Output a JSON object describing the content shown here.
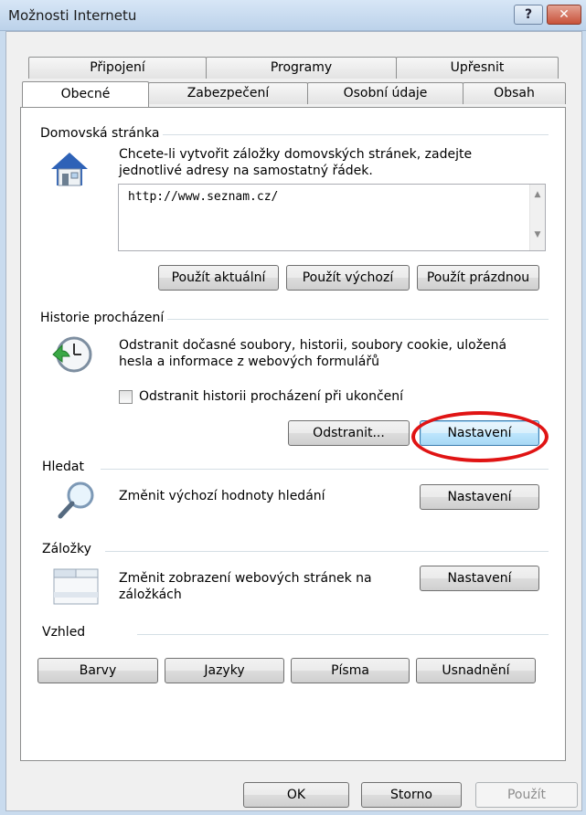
{
  "window": {
    "title": "Možnosti Internetu",
    "help_label": "?",
    "close_label": "✕"
  },
  "tabs_top": [
    {
      "label": "Připojení"
    },
    {
      "label": "Programy"
    },
    {
      "label": "Upřesnit"
    }
  ],
  "tabs_bottom": [
    {
      "label": "Obecné"
    },
    {
      "label": "Zabezpečení"
    },
    {
      "label": "Osobní údaje"
    },
    {
      "label": "Obsah"
    }
  ],
  "homepage": {
    "label": "Domovská stránka",
    "description_line1": "Chcete-li vytvořit záložky domovských stránek, zadejte",
    "description_line2": "jednotlivé adresy na samostatný řádek.",
    "url": "http://www.seznam.cz/",
    "use_current": "Použít aktuální",
    "use_default": "Použít výchozí",
    "use_blank": "Použít prázdnou"
  },
  "history": {
    "label": "Historie procházení",
    "description_line1": "Odstranit dočasné soubory, historii, soubory cookie, uložená",
    "description_line2": "hesla a informace z webových formulářů",
    "checkbox_label": "Odstranit historii procházení při ukončení",
    "checkbox_checked": false,
    "delete_button": "Odstranit...",
    "settings_button": "Nastavení"
  },
  "search": {
    "label": "Hledat",
    "description": "Změnit výchozí hodnoty hledání",
    "settings_button": "Nastavení"
  },
  "tabs_section": {
    "label": "Záložky",
    "description_line1": "Změnit zobrazení webových stránek na",
    "description_line2": "záložkách",
    "settings_button": "Nastavení"
  },
  "appearance": {
    "label": "Vzhled",
    "colors": "Barvy",
    "languages": "Jazyky",
    "fonts": "Písma",
    "accessibility": "Usnadnění"
  },
  "footer": {
    "ok": "OK",
    "cancel": "Storno",
    "apply": "Použít"
  },
  "colors": {
    "annotation": "#e01414",
    "focus_border": "#3c7fb1"
  },
  "icons": {
    "home": "house-icon",
    "history": "clock-arrow-icon",
    "search": "magnifier-icon",
    "tabs": "tabbed-window-icon"
  }
}
